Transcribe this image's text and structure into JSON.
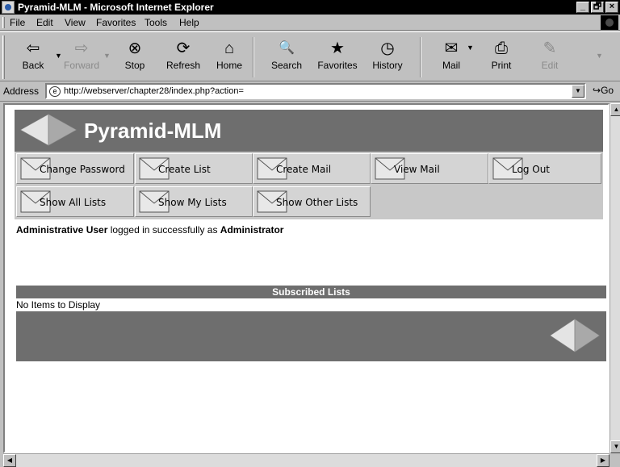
{
  "window": {
    "title": "Pyramid-MLM - Microsoft Internet Explorer",
    "controls": [
      "_",
      "🗗",
      "×"
    ]
  },
  "menubar": {
    "items": [
      {
        "label": "File"
      },
      {
        "label": "Edit"
      },
      {
        "label": "View"
      },
      {
        "label": "Favorites"
      },
      {
        "label": "Tools"
      },
      {
        "label": "Help"
      }
    ]
  },
  "toolbar": {
    "buttons": [
      {
        "label": "Back",
        "icon": "back-arrow-icon",
        "glyph": "⇦",
        "enabled": true
      },
      {
        "label": "Forward",
        "icon": "forward-arrow-icon",
        "glyph": "⇨",
        "enabled": false
      },
      {
        "label": "Stop",
        "icon": "stop-icon",
        "glyph": "⊗",
        "enabled": true
      },
      {
        "label": "Refresh",
        "icon": "refresh-icon",
        "glyph": "⟳",
        "enabled": true
      },
      {
        "label": "Home",
        "icon": "home-icon",
        "glyph": "⌂",
        "enabled": true
      },
      {
        "label": "Search",
        "icon": "search-icon",
        "glyph": "🔍",
        "enabled": true
      },
      {
        "label": "Favorites",
        "icon": "favorites-icon",
        "glyph": "★",
        "enabled": true
      },
      {
        "label": "History",
        "icon": "history-icon",
        "glyph": "◷",
        "enabled": true
      },
      {
        "label": "Mail",
        "icon": "mail-icon",
        "glyph": "✉",
        "enabled": true
      },
      {
        "label": "Print",
        "icon": "print-icon",
        "glyph": "⎙",
        "enabled": true
      },
      {
        "label": "Edit",
        "icon": "edit-icon",
        "glyph": "✎",
        "enabled": false
      }
    ]
  },
  "addressbar": {
    "label": "Address",
    "url": "http://webserver/chapter28/index.php?action=",
    "go_label": "Go"
  },
  "page": {
    "site_title": "Pyramid-MLM",
    "nav": [
      {
        "label": "Change Password"
      },
      {
        "label": "Create List"
      },
      {
        "label": "Create Mail"
      },
      {
        "label": "View Mail"
      },
      {
        "label": "Log Out"
      },
      {
        "label": "Show All Lists"
      },
      {
        "label": "Show My Lists"
      },
      {
        "label": "Show Other Lists"
      }
    ],
    "login_message": {
      "user": "Administrative User",
      "middle": " logged in successfully as ",
      "role": "Administrator"
    },
    "section_title": "Subscribed Lists",
    "empty_message": "No Items to Display"
  },
  "colors": {
    "banner": "#6e6e6e",
    "nav_background": "#c8c8c8",
    "titlebar": "#000000"
  }
}
